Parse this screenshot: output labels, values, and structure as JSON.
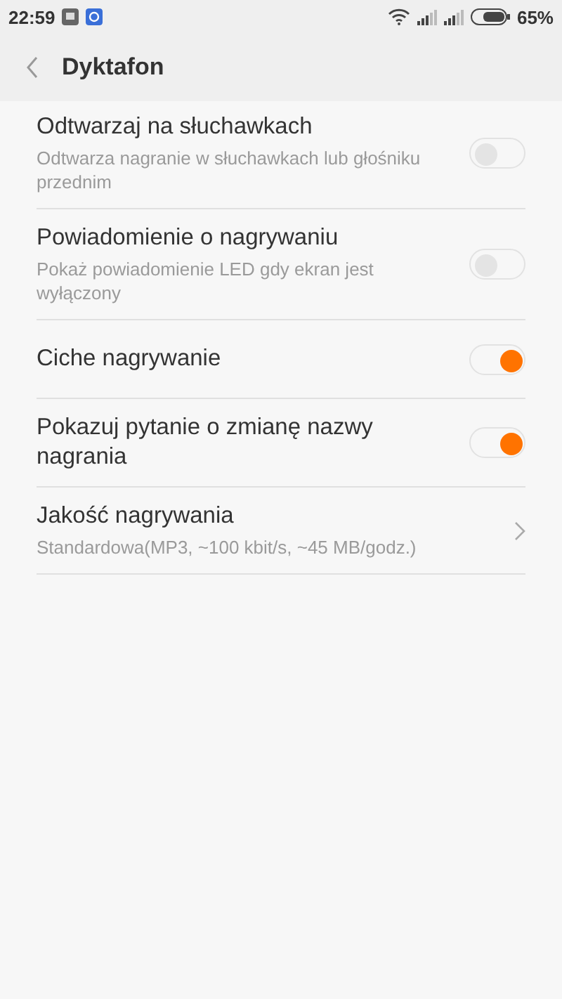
{
  "status_bar": {
    "time": "22:59",
    "battery": "65%"
  },
  "header": {
    "title": "Dyktafon"
  },
  "settings": [
    {
      "kind": "toggle",
      "title": "Odtwarzaj na słuchawkach",
      "subtitle": "Odtwarza nagranie w słuchawkach lub głośniku przednim",
      "on": false
    },
    {
      "kind": "toggle",
      "title": "Powiadomienie o nagrywaniu",
      "subtitle": "Pokaż powiadomienie LED gdy ekran jest wyłączony",
      "on": false
    },
    {
      "kind": "toggle",
      "title": "Ciche nagrywanie",
      "on": true
    },
    {
      "kind": "toggle",
      "title": "Pokazuj pytanie o zmianę nazwy nagrania",
      "on": true
    },
    {
      "kind": "link",
      "title": "Jakość nagrywania",
      "subtitle": "Standardowa(MP3, ~100 kbit/s, ~45 MB/godz.)"
    }
  ]
}
